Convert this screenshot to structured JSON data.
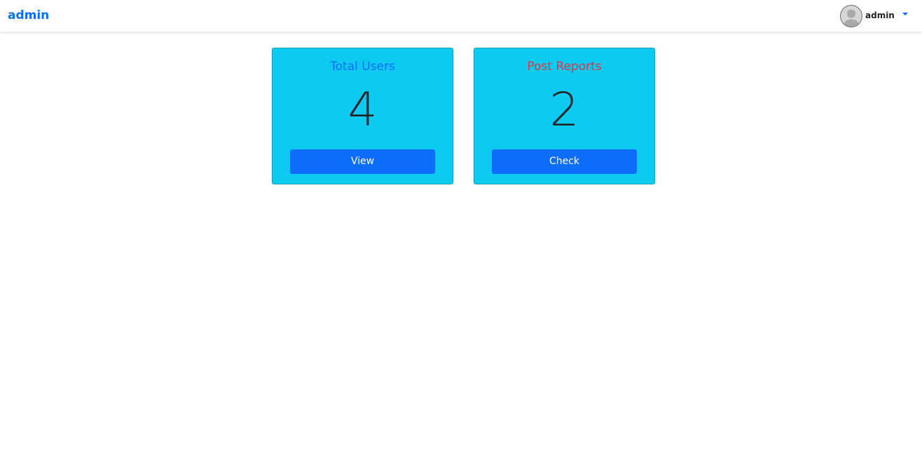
{
  "navbar": {
    "brand": "admin",
    "user": {
      "name": "admin",
      "avatar_icon": "user-avatar-icon",
      "menu_icon": "caret-down-icon"
    }
  },
  "cards": [
    {
      "title": "Total Users",
      "value": "4",
      "button_label": "View",
      "title_color": "#0d6efd"
    },
    {
      "title": "Post Reports",
      "value": "2",
      "button_label": "Check",
      "title_color": "#dc3545"
    }
  ],
  "colors": {
    "card_background": "#0dcaf0",
    "primary": "#0d6efd",
    "danger": "#dc3545"
  }
}
